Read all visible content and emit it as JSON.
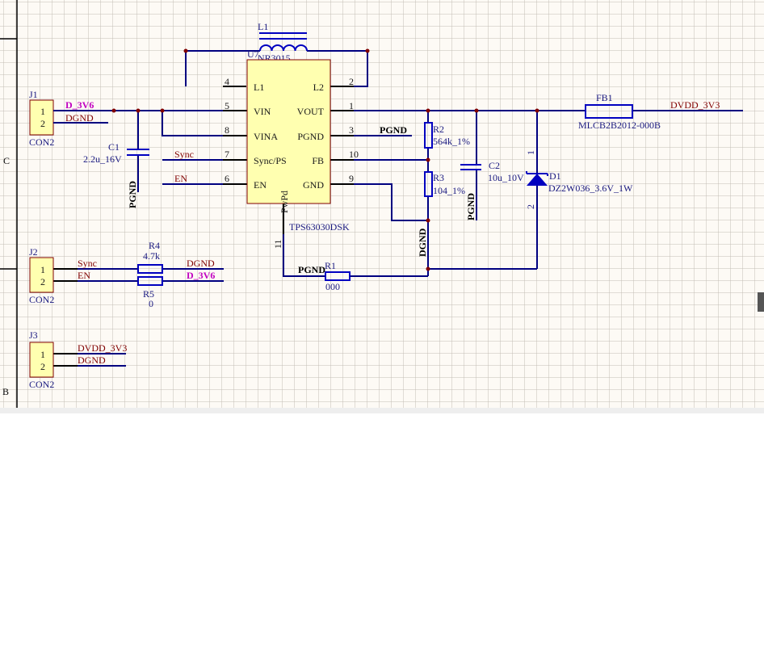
{
  "sheet": {
    "zone_c": "C",
    "zone_b": "B"
  },
  "j1": {
    "designator": "J1",
    "comment": "CON2",
    "pin1": "1",
    "pin2": "2",
    "net1": "D_3V6",
    "net2": "DGND"
  },
  "j2": {
    "designator": "J2",
    "comment": "CON2",
    "pin1": "1",
    "pin2": "2",
    "net1": "Sync",
    "net2": "EN"
  },
  "j3": {
    "designator": "J3",
    "comment": "CON2",
    "pin1": "1",
    "pin2": "2",
    "net1": "DVDD_3V3",
    "net2": "DGND"
  },
  "c1": {
    "designator": "C1",
    "value": "2.2u_16V",
    "power": "PGND"
  },
  "c2": {
    "designator": "C2",
    "value": "10u_10V",
    "power": "PGND"
  },
  "l1": {
    "designator": "L1",
    "value": "NR3015"
  },
  "u7": {
    "designator": "U7",
    "part": "TPS63030DSK",
    "left_pins": [
      {
        "num": "4",
        "name": "L1"
      },
      {
        "num": "5",
        "name": "VIN"
      },
      {
        "num": "8",
        "name": "VINA"
      },
      {
        "num": "7",
        "name": "Sync/PS"
      },
      {
        "num": "6",
        "name": "EN"
      }
    ],
    "right_pins": [
      {
        "num": "2",
        "name": "L2"
      },
      {
        "num": "1",
        "name": "VOUT"
      },
      {
        "num": "3",
        "name": "PGND"
      },
      {
        "num": "10",
        "name": "FB"
      },
      {
        "num": "9",
        "name": "GND"
      }
    ],
    "bottom_pin": {
      "num": "11",
      "name": "PwPd"
    }
  },
  "nets": {
    "sync": "Sync",
    "en": "EN",
    "pgnd_pin3": "PGND",
    "pgnd_r1": "PGND",
    "dgnd": "DGND",
    "dvdd": "DVDD_3V3",
    "r4_net": "DGND",
    "r5_net": "D_3V6"
  },
  "r1": {
    "designator": "R1",
    "value": "000"
  },
  "r2": {
    "designator": "R2",
    "value": "564k_1%"
  },
  "r3": {
    "designator": "R3",
    "value": "104_1%"
  },
  "r4": {
    "designator": "R4",
    "value": "4.7k"
  },
  "r5": {
    "designator": "R5",
    "value": "0"
  },
  "d1": {
    "designator": "D1",
    "value": "DZ2W036_3.6V_1W",
    "pin1": "1",
    "pin2": "2"
  },
  "fb1": {
    "designator": "FB1",
    "value": "MLCB2B2012-000B"
  },
  "colors": {
    "wire": "#000080",
    "component_fill": "#ffffb0",
    "component_border": "#800000",
    "net_label": "#800000",
    "power_net_label": "#c000c0",
    "grid": "#c4bdb5",
    "sheet_bg": "#fdfaf5"
  }
}
